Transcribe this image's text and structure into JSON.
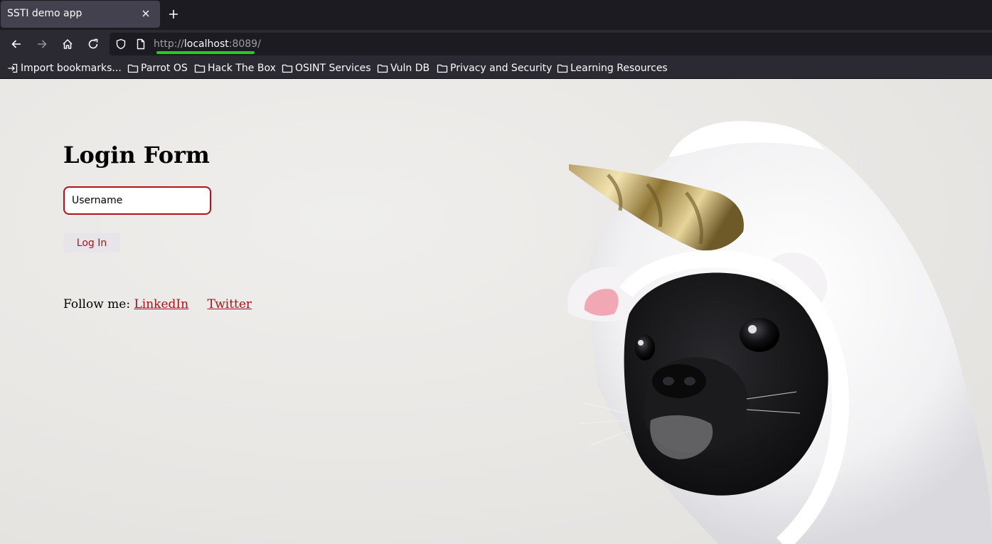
{
  "browser": {
    "tab": {
      "title": "SSTI demo app"
    },
    "url": {
      "scheme": "http://",
      "host": "localhost",
      "port": ":8089/"
    },
    "bookmarks": [
      {
        "label": "Import bookmarks..."
      },
      {
        "label": "Parrot OS"
      },
      {
        "label": "Hack The Box"
      },
      {
        "label": "OSINT Services"
      },
      {
        "label": "Vuln DB"
      },
      {
        "label": "Privacy and Security"
      },
      {
        "label": "Learning Resources"
      }
    ],
    "colors": {
      "url_highlight": "#22cc22"
    }
  },
  "page": {
    "title": "Login Form",
    "username": {
      "placeholder": "Username",
      "value": ""
    },
    "login_button": "Log In",
    "follow": {
      "prefix": "Follow me:",
      "links": [
        {
          "label": "LinkedIn"
        },
        {
          "label": "Twitter"
        }
      ]
    },
    "colors": {
      "accent": "#b3101a"
    }
  }
}
